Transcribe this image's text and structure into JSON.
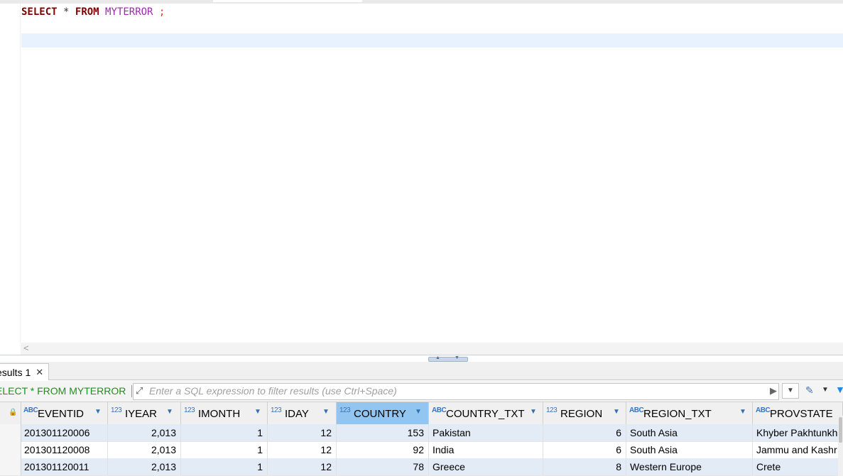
{
  "editor": {
    "sql": {
      "kw_select": "SELECT",
      "star": "*",
      "kw_from": "FROM",
      "table": "MYTERROR",
      "semicolon": ";"
    },
    "scroll_left_glyph": "<"
  },
  "results": {
    "tab_label": "esults 1",
    "tab_close": "✕",
    "filter_query": "ELECT * FROM MYTERROR",
    "filter_placeholder": "Enter a SQL expression to filter results (use Ctrl+Space)"
  },
  "grid": {
    "columns": [
      {
        "type": "ABC",
        "name": "EVENTID"
      },
      {
        "type": "123",
        "name": "IYEAR"
      },
      {
        "type": "123",
        "name": "IMONTH"
      },
      {
        "type": "123",
        "name": "IDAY"
      },
      {
        "type": "123",
        "name": "COUNTRY",
        "selected": true
      },
      {
        "type": "ABC",
        "name": "COUNTRY_TXT"
      },
      {
        "type": "123",
        "name": "REGION"
      },
      {
        "type": "ABC",
        "name": "REGION_TXT"
      },
      {
        "type": "ABC",
        "name": "PROVSTATE"
      }
    ],
    "rows": [
      [
        "201301120006",
        "2,013",
        "1",
        "12",
        "153",
        "Pakistan",
        "6",
        "South Asia",
        "Khyber Pakhtunkh"
      ],
      [
        "201301120008",
        "2,013",
        "1",
        "12",
        "92",
        "India",
        "6",
        "South Asia",
        "Jammu and Kashr"
      ],
      [
        "201301120011",
        "2,013",
        "1",
        "12",
        "78",
        "Greece",
        "8",
        "Western Europe",
        "Crete"
      ]
    ]
  },
  "colors": {
    "keyword": "#7f0000",
    "table_name": "#9c27b0",
    "semicolon": "#ff3300",
    "filter_query": "#1f8f1f",
    "selected_header": "#92c5f0",
    "current_line": "#e8f2fe"
  }
}
